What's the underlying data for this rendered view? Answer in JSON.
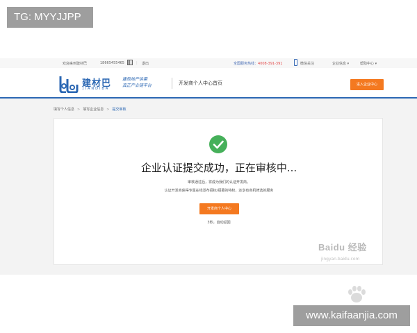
{
  "overlay": {
    "top_badge": "TG: MYYJJPP",
    "bottom_badge": "www.kaifaanjia.com"
  },
  "topbar": {
    "welcome": "欢迎来到建材巴",
    "phone": "18665455465",
    "logout": "退出",
    "hotline_label": "全国服务热线：",
    "hotline_number": "4008-391-391",
    "wechat": "微信关注",
    "menu_enterprise": "企业信息 ▾",
    "menu_help": "帮助中心 ▾"
  },
  "header": {
    "logo_cn": "建材巴",
    "logo_en": "JIANDIBA",
    "slogan_line1": "建筑地产供需",
    "slogan_line2": "真正产业链平台",
    "title": "开发商个人中心首页",
    "enter_button": "进入企业中心"
  },
  "breadcrumb": {
    "step1": "填写个人信息",
    "step2": "填写企业信息",
    "step3": "提交审核"
  },
  "card": {
    "main_message": "企业认证提交成功，正在审核中...",
    "sub1": "审核通过后，将成为我们的认证开发商。",
    "sub2": "认证开发商获得专属在线发布招标/招募的特权，还享有商机筛选的服务",
    "center_button": "开发商个人中心",
    "redirect": "3秒，自动返回"
  },
  "watermark": {
    "brand": "Baidu 经验",
    "url": "jingyan.baidu.com"
  },
  "colors": {
    "accent_orange": "#f47920",
    "brand_blue": "#2b67b3",
    "success_green": "#46b05a"
  },
  "icons": [
    "qr-code-icon",
    "phone-icon",
    "success-check-icon",
    "baidu-paw-icon"
  ]
}
